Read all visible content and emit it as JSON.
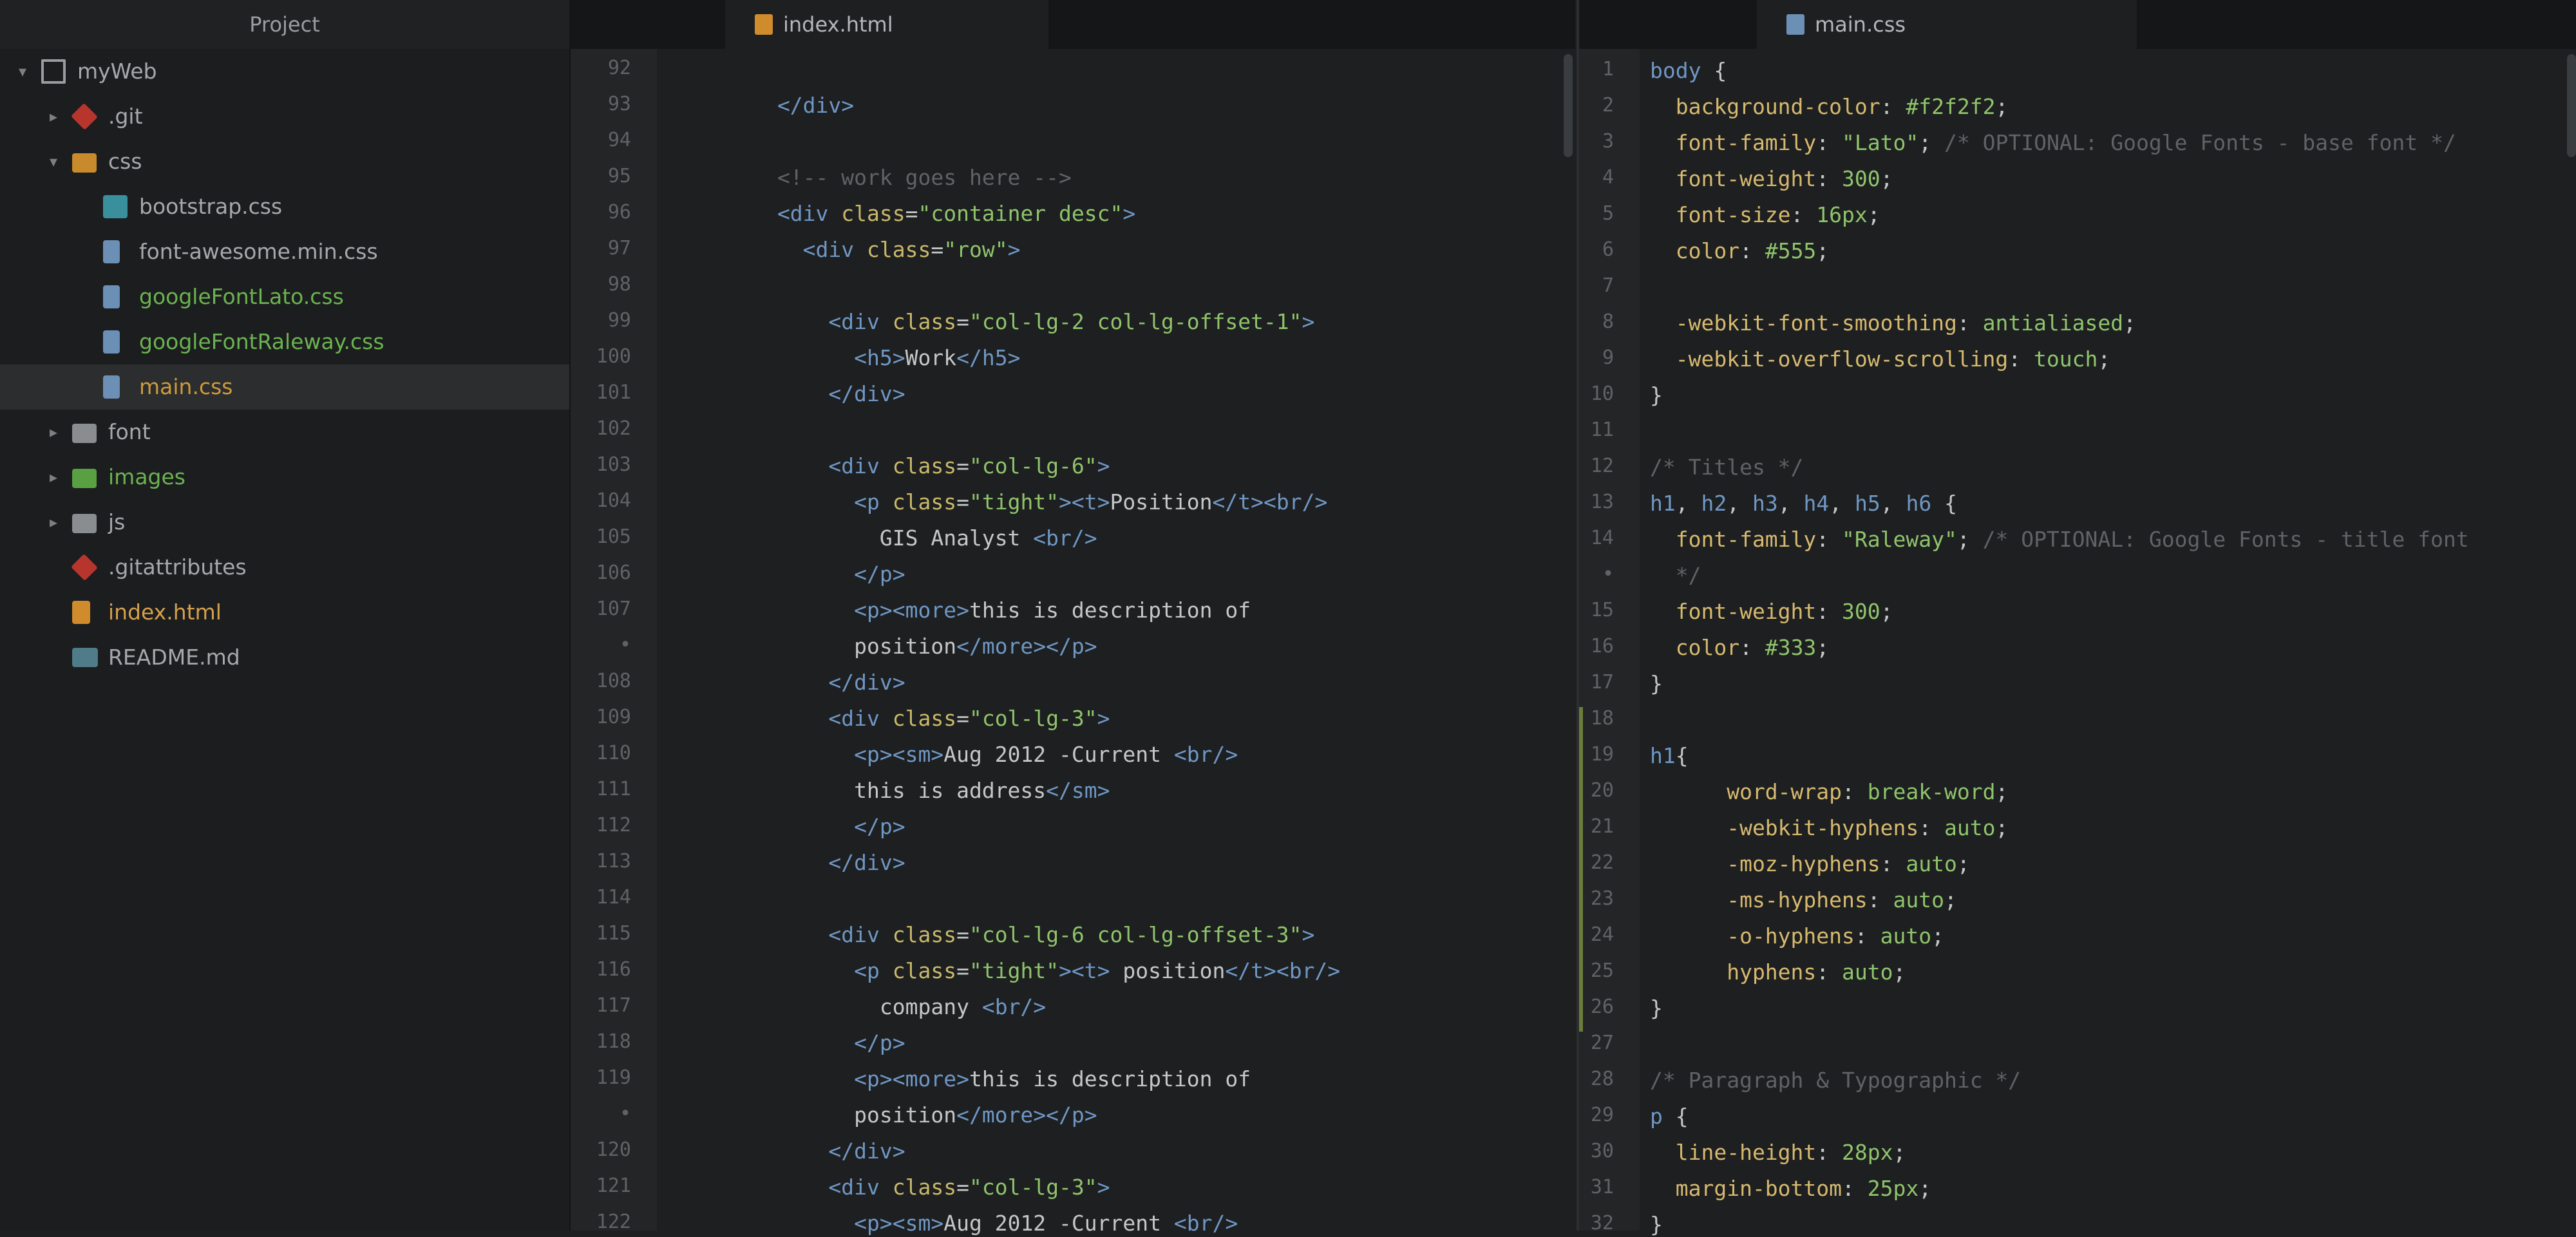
{
  "tree": {
    "title": "Project",
    "items": [
      {
        "label": "myWeb",
        "icon": "repo-icon",
        "depth": 0,
        "arrow": "▾"
      },
      {
        "label": ".git",
        "icon": "git-icon",
        "depth": 1,
        "arrow": "▸"
      },
      {
        "label": "css",
        "icon": "folder-icon",
        "depth": 1,
        "arrow": "▾",
        "color": "orange"
      },
      {
        "label": "bootstrap.css",
        "icon": "css-file-icon",
        "depth": 2
      },
      {
        "label": "font-awesome.min.css",
        "icon": "css-file-icon",
        "depth": 2
      },
      {
        "label": "googleFontLato.css",
        "icon": "css-file-icon",
        "depth": 2,
        "color": "green"
      },
      {
        "label": "googleFontRaleway.css",
        "icon": "css-file-icon",
        "depth": 2,
        "color": "green"
      },
      {
        "label": "main.css",
        "icon": "css-file-icon",
        "depth": 2,
        "color": "amber",
        "selected": true
      },
      {
        "label": "font",
        "icon": "folder-icon",
        "depth": 1,
        "arrow": "▸"
      },
      {
        "label": "images",
        "icon": "folder-icon",
        "depth": 1,
        "arrow": "▸",
        "color": "green"
      },
      {
        "label": "js",
        "icon": "folder-icon",
        "depth": 1,
        "arrow": "▸"
      },
      {
        "label": ".gitattributes",
        "icon": "git-icon",
        "depth": 1
      },
      {
        "label": "index.html",
        "icon": "html-file-icon",
        "depth": 1,
        "color": "orange"
      },
      {
        "label": "README.md",
        "icon": "markdown-file-icon",
        "depth": 1
      }
    ]
  },
  "left_pane": {
    "tab_label": "index.html",
    "lines": [
      {
        "no": "92",
        "code": []
      },
      {
        "no": "93",
        "code": [
          [
            "tok-tag",
            "        </div>"
          ]
        ]
      },
      {
        "no": "94",
        "code": []
      },
      {
        "no": "95",
        "code": [
          [
            "tok-com",
            "        <!-- work goes here -->"
          ]
        ]
      },
      {
        "no": "96",
        "code": [
          [
            "tok-tag",
            "        <div "
          ],
          [
            "tok-attr",
            "class"
          ],
          [
            "tok-punc",
            "="
          ],
          [
            "tok-str",
            "\"container desc\""
          ],
          [
            "tok-tag",
            ">"
          ]
        ]
      },
      {
        "no": "97",
        "code": [
          [
            "tok-tag",
            "          <div "
          ],
          [
            "tok-attr",
            "class"
          ],
          [
            "tok-punc",
            "="
          ],
          [
            "tok-str",
            "\"row\""
          ],
          [
            "tok-tag",
            ">"
          ]
        ]
      },
      {
        "no": "98",
        "code": []
      },
      {
        "no": "99",
        "code": [
          [
            "tok-tag",
            "            <div "
          ],
          [
            "tok-attr",
            "class"
          ],
          [
            "tok-punc",
            "="
          ],
          [
            "tok-str",
            "\"col-lg-2 col-lg-offset-1\""
          ],
          [
            "tok-tag",
            ">"
          ]
        ]
      },
      {
        "no": "100",
        "code": [
          [
            "tok-tag",
            "              <h5>"
          ],
          [
            "tok-text",
            "Work"
          ],
          [
            "tok-tag",
            "</h5>"
          ]
        ]
      },
      {
        "no": "101",
        "code": [
          [
            "tok-tag",
            "            </div>"
          ]
        ]
      },
      {
        "no": "102",
        "code": []
      },
      {
        "no": "103",
        "code": [
          [
            "tok-tag",
            "            <div "
          ],
          [
            "tok-attr",
            "class"
          ],
          [
            "tok-punc",
            "="
          ],
          [
            "tok-str",
            "\"col-lg-6\""
          ],
          [
            "tok-tag",
            ">"
          ]
        ]
      },
      {
        "no": "104",
        "code": [
          [
            "tok-tag",
            "              <p "
          ],
          [
            "tok-attr",
            "class"
          ],
          [
            "tok-punc",
            "="
          ],
          [
            "tok-str",
            "\"tight\""
          ],
          [
            "tok-tag",
            "><t>"
          ],
          [
            "tok-text",
            "Position"
          ],
          [
            "tok-tag",
            "</t><br/>"
          ]
        ]
      },
      {
        "no": "105",
        "code": [
          [
            "tok-text",
            "                GIS Analyst "
          ],
          [
            "tok-tag",
            "<br/>"
          ]
        ]
      },
      {
        "no": "106",
        "code": [
          [
            "tok-tag",
            "              </p>"
          ]
        ]
      },
      {
        "no": "107",
        "code": [
          [
            "tok-tag",
            "              <p><more>"
          ],
          [
            "tok-text",
            "this is description of"
          ]
        ]
      },
      {
        "no": "•",
        "code": [
          [
            "tok-text",
            "              position"
          ],
          [
            "tok-tag",
            "</more></p>"
          ]
        ]
      },
      {
        "no": "108",
        "code": [
          [
            "tok-tag",
            "            </div>"
          ]
        ]
      },
      {
        "no": "109",
        "code": [
          [
            "tok-tag",
            "            <div "
          ],
          [
            "tok-attr",
            "class"
          ],
          [
            "tok-punc",
            "="
          ],
          [
            "tok-str",
            "\"col-lg-3\""
          ],
          [
            "tok-tag",
            ">"
          ]
        ]
      },
      {
        "no": "110",
        "code": [
          [
            "tok-tag",
            "              <p><sm>"
          ],
          [
            "tok-text",
            "Aug 2012 -Current "
          ],
          [
            "tok-tag",
            "<br/>"
          ]
        ]
      },
      {
        "no": "111",
        "code": [
          [
            "tok-text",
            "              this is address"
          ],
          [
            "tok-tag",
            "</sm>"
          ]
        ]
      },
      {
        "no": "112",
        "code": [
          [
            "tok-tag",
            "              </p>"
          ]
        ]
      },
      {
        "no": "113",
        "code": [
          [
            "tok-tag",
            "            </div>"
          ]
        ]
      },
      {
        "no": "114",
        "code": []
      },
      {
        "no": "115",
        "code": [
          [
            "tok-tag",
            "            <div "
          ],
          [
            "tok-attr",
            "class"
          ],
          [
            "tok-punc",
            "="
          ],
          [
            "tok-str",
            "\"col-lg-6 col-lg-offset-3\""
          ],
          [
            "tok-tag",
            ">"
          ]
        ]
      },
      {
        "no": "116",
        "code": [
          [
            "tok-tag",
            "              <p "
          ],
          [
            "tok-attr",
            "class"
          ],
          [
            "tok-punc",
            "="
          ],
          [
            "tok-str",
            "\"tight\""
          ],
          [
            "tok-tag",
            "><t>"
          ],
          [
            "tok-text",
            " position"
          ],
          [
            "tok-tag",
            "</t><br/>"
          ]
        ]
      },
      {
        "no": "117",
        "code": [
          [
            "tok-text",
            "                company "
          ],
          [
            "tok-tag",
            "<br/>"
          ]
        ]
      },
      {
        "no": "118",
        "code": [
          [
            "tok-tag",
            "              </p>"
          ]
        ]
      },
      {
        "no": "119",
        "code": [
          [
            "tok-tag",
            "              <p><more>"
          ],
          [
            "tok-text",
            "this is description of"
          ]
        ]
      },
      {
        "no": "•",
        "code": [
          [
            "tok-text",
            "              position"
          ],
          [
            "tok-tag",
            "</more></p>"
          ]
        ]
      },
      {
        "no": "120",
        "code": [
          [
            "tok-tag",
            "            </div>"
          ]
        ]
      },
      {
        "no": "121",
        "code": [
          [
            "tok-tag",
            "            <div "
          ],
          [
            "tok-attr",
            "class"
          ],
          [
            "tok-punc",
            "="
          ],
          [
            "tok-str",
            "\"col-lg-3\""
          ],
          [
            "tok-tag",
            ">"
          ]
        ]
      },
      {
        "no": "122",
        "code": [
          [
            "tok-tag",
            "              <p><sm>"
          ],
          [
            "tok-text",
            "Aug 2012 -Current "
          ],
          [
            "tok-tag",
            "<br/>"
          ]
        ]
      }
    ]
  },
  "right_pane": {
    "tab_label": "main.css",
    "lines": [
      {
        "no": "1",
        "code": [
          [
            "tok-sel",
            "body"
          ],
          [
            "tok-punc",
            " {"
          ]
        ]
      },
      {
        "no": "2",
        "code": [
          [
            "tok-prop",
            "  background-color"
          ],
          [
            "tok-punc",
            ": "
          ],
          [
            "tok-num",
            "#f2f2f2"
          ],
          [
            "tok-punc",
            ";"
          ]
        ]
      },
      {
        "no": "3",
        "code": [
          [
            "tok-prop",
            "  font-family"
          ],
          [
            "tok-punc",
            ": "
          ],
          [
            "tok-str",
            "\"Lato\""
          ],
          [
            "tok-punc",
            "; "
          ],
          [
            "tok-com",
            "/* OPTIONAL: Google Fonts - base font */"
          ]
        ]
      },
      {
        "no": "4",
        "code": [
          [
            "tok-prop",
            "  font-weight"
          ],
          [
            "tok-punc",
            ": "
          ],
          [
            "tok-num",
            "300"
          ],
          [
            "tok-punc",
            ";"
          ]
        ]
      },
      {
        "no": "5",
        "code": [
          [
            "tok-prop",
            "  font-size"
          ],
          [
            "tok-punc",
            ": "
          ],
          [
            "tok-num",
            "16px"
          ],
          [
            "tok-punc",
            ";"
          ]
        ]
      },
      {
        "no": "6",
        "code": [
          [
            "tok-prop",
            "  color"
          ],
          [
            "tok-punc",
            ": "
          ],
          [
            "tok-num",
            "#555"
          ],
          [
            "tok-punc",
            ";"
          ]
        ]
      },
      {
        "no": "7",
        "code": []
      },
      {
        "no": "8",
        "code": [
          [
            "tok-prop",
            "  -webkit-font-smoothing"
          ],
          [
            "tok-punc",
            ": "
          ],
          [
            "tok-val",
            "antialiased"
          ],
          [
            "tok-punc",
            ";"
          ]
        ]
      },
      {
        "no": "9",
        "code": [
          [
            "tok-prop",
            "  -webkit-overflow-scrolling"
          ],
          [
            "tok-punc",
            ": "
          ],
          [
            "tok-val",
            "touch"
          ],
          [
            "tok-punc",
            ";"
          ]
        ]
      },
      {
        "no": "10",
        "code": [
          [
            "tok-punc",
            "}"
          ]
        ]
      },
      {
        "no": "11",
        "code": []
      },
      {
        "no": "12",
        "code": [
          [
            "tok-com",
            "/* Titles */"
          ]
        ]
      },
      {
        "no": "13",
        "code": [
          [
            "tok-sel",
            "h1"
          ],
          [
            "tok-punc",
            ", "
          ],
          [
            "tok-sel",
            "h2"
          ],
          [
            "tok-punc",
            ", "
          ],
          [
            "tok-sel",
            "h3"
          ],
          [
            "tok-punc",
            ", "
          ],
          [
            "tok-sel",
            "h4"
          ],
          [
            "tok-punc",
            ", "
          ],
          [
            "tok-sel",
            "h5"
          ],
          [
            "tok-punc",
            ", "
          ],
          [
            "tok-sel",
            "h6"
          ],
          [
            "tok-punc",
            " {"
          ]
        ]
      },
      {
        "no": "14",
        "code": [
          [
            "tok-prop",
            "  font-family"
          ],
          [
            "tok-punc",
            ": "
          ],
          [
            "tok-str",
            "\"Raleway\""
          ],
          [
            "tok-punc",
            "; "
          ],
          [
            "tok-com",
            "/* OPTIONAL: Google Fonts - title font"
          ]
        ]
      },
      {
        "no": "•",
        "code": [
          [
            "tok-com",
            "  */"
          ]
        ]
      },
      {
        "no": "15",
        "code": [
          [
            "tok-prop",
            "  font-weight"
          ],
          [
            "tok-punc",
            ": "
          ],
          [
            "tok-num",
            "300"
          ],
          [
            "tok-punc",
            ";"
          ]
        ]
      },
      {
        "no": "16",
        "code": [
          [
            "tok-prop",
            "  color"
          ],
          [
            "tok-punc",
            ": "
          ],
          [
            "tok-num",
            "#333"
          ],
          [
            "tok-punc",
            ";"
          ]
        ]
      },
      {
        "no": "17",
        "code": [
          [
            "tok-punc",
            "}"
          ]
        ]
      },
      {
        "no": "18",
        "code": []
      },
      {
        "no": "19",
        "code": [
          [
            "tok-sel",
            "h1"
          ],
          [
            "tok-punc",
            "{"
          ]
        ]
      },
      {
        "no": "20",
        "code": [
          [
            "tok-prop",
            "      word-wrap"
          ],
          [
            "tok-punc",
            ": "
          ],
          [
            "tok-val",
            "break-word"
          ],
          [
            "tok-punc",
            ";"
          ]
        ]
      },
      {
        "no": "21",
        "code": [
          [
            "tok-prop",
            "      -webkit-hyphens"
          ],
          [
            "tok-punc",
            ": "
          ],
          [
            "tok-val",
            "auto"
          ],
          [
            "tok-punc",
            ";"
          ]
        ]
      },
      {
        "no": "22",
        "code": [
          [
            "tok-prop",
            "      -moz-hyphens"
          ],
          [
            "tok-punc",
            ": "
          ],
          [
            "tok-val",
            "auto"
          ],
          [
            "tok-punc",
            ";"
          ]
        ]
      },
      {
        "no": "23",
        "code": [
          [
            "tok-prop",
            "      -ms-hyphens"
          ],
          [
            "tok-punc",
            ": "
          ],
          [
            "tok-val",
            "auto"
          ],
          [
            "tok-punc",
            ";"
          ]
        ]
      },
      {
        "no": "24",
        "code": [
          [
            "tok-prop",
            "      -o-hyphens"
          ],
          [
            "tok-punc",
            ": "
          ],
          [
            "tok-val",
            "auto"
          ],
          [
            "tok-punc",
            ";"
          ]
        ]
      },
      {
        "no": "25",
        "code": [
          [
            "tok-prop",
            "      hyphens"
          ],
          [
            "tok-punc",
            ": "
          ],
          [
            "tok-val",
            "auto"
          ],
          [
            "tok-punc",
            ";"
          ]
        ]
      },
      {
        "no": "26",
        "code": [
          [
            "tok-punc",
            "}"
          ]
        ]
      },
      {
        "no": "27",
        "code": []
      },
      {
        "no": "28",
        "code": [
          [
            "tok-com",
            "/* Paragraph & Typographic */"
          ]
        ]
      },
      {
        "no": "29",
        "code": [
          [
            "tok-sel",
            "p"
          ],
          [
            "tok-punc",
            " {"
          ]
        ]
      },
      {
        "no": "30",
        "code": [
          [
            "tok-prop",
            "  line-height"
          ],
          [
            "tok-punc",
            ": "
          ],
          [
            "tok-num",
            "28px"
          ],
          [
            "tok-punc",
            ";"
          ]
        ]
      },
      {
        "no": "31",
        "code": [
          [
            "tok-prop",
            "  margin-bottom"
          ],
          [
            "tok-punc",
            ": "
          ],
          [
            "tok-num",
            "25px"
          ],
          [
            "tok-punc",
            ";"
          ]
        ]
      },
      {
        "no": "32",
        "code": [
          [
            "tok-punc",
            "}"
          ]
        ]
      }
    ]
  }
}
